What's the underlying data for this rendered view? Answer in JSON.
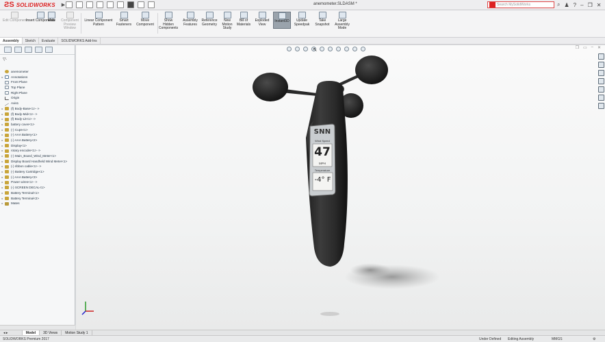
{
  "app": {
    "brand": "SOLIDWORKS",
    "document_title": "anemometer.SLDASM *"
  },
  "search": {
    "placeholder": "Search MySolidWorks"
  },
  "ribbon": [
    {
      "label": "Edit Component",
      "enabled": false
    },
    {
      "label": "Insert Components"
    },
    {
      "label": "Mate"
    },
    {
      "label": "Component Preview Window",
      "enabled": false
    },
    {
      "label": "Linear Component Pattern"
    },
    {
      "label": "Smart Fasteners"
    },
    {
      "label": "Move Component"
    },
    {
      "label": "Show Hidden Components"
    },
    {
      "label": "Assembly Features"
    },
    {
      "label": "Reference Geometry"
    },
    {
      "label": "New Motion Study"
    },
    {
      "label": "Bill of Materials"
    },
    {
      "label": "Exploded View"
    },
    {
      "label": "Instant3D",
      "active": true
    },
    {
      "label": "Update Speedpak"
    },
    {
      "label": "Take Snapshot"
    },
    {
      "label": "Large Assembly Mode"
    }
  ],
  "command_tabs": [
    "Assembly",
    "Sketch",
    "Evaluate",
    "SOLIDWORKS Add-Ins"
  ],
  "tree": {
    "root": "anemometer",
    "items": [
      {
        "label": "Annotations",
        "icon": "annotations-icon"
      },
      {
        "label": "Front Plane",
        "icon": "plane-icon"
      },
      {
        "label": "Top Plane",
        "icon": "plane-icon"
      },
      {
        "label": "Right Plane",
        "icon": "plane-icon"
      },
      {
        "label": "Origin",
        "icon": "origin-icon"
      },
      {
        "label": "Axis1",
        "icon": "axis-icon"
      },
      {
        "label": "(f) Body-Base<1> ->",
        "icon": "component-icon"
      },
      {
        "label": "(f) Body-Mid<1> ->",
        "icon": "component-icon"
      },
      {
        "label": "(f) Body-Lit<1> ->",
        "icon": "component-icon"
      },
      {
        "label": "battery cover<1>",
        "icon": "component-icon"
      },
      {
        "label": "(-) Cups<1>",
        "icon": "component-icon"
      },
      {
        "label": "(-) AAA Battery<1>",
        "icon": "component-icon"
      },
      {
        "label": "(-) AAA Battery<2>",
        "icon": "component-icon"
      },
      {
        "label": "Display<1>",
        "icon": "component-icon"
      },
      {
        "label": "rotary encoder<1> ->",
        "icon": "component-icon"
      },
      {
        "label": "(-) Main_Board_Wind_Meter<1>",
        "icon": "component-icon"
      },
      {
        "label": "Display Board Handheld Wind Meter<1>",
        "icon": "component-icon"
      },
      {
        "label": "(-) ribbon cable<1> ->",
        "icon": "component-icon"
      },
      {
        "label": "(-) Battery Cartridge<1>",
        "icon": "component-icon"
      },
      {
        "label": "(-) AAA Battery<3>",
        "icon": "component-icon"
      },
      {
        "label": "Power wires<1> ->",
        "icon": "component-icon"
      },
      {
        "label": "(-) SCREEN DECAL<1>",
        "icon": "component-icon"
      },
      {
        "label": "Battery Terminal<1>",
        "icon": "component-icon"
      },
      {
        "label": "Battery Terminal<2>",
        "icon": "component-icon"
      },
      {
        "label": "Mates",
        "icon": "mates-icon"
      }
    ]
  },
  "display": {
    "brand": "SNN",
    "label_top": "Wind Speed",
    "speed_value": "47",
    "speed_unit": "MPH",
    "label_bottom": "Temperature",
    "temperature": "-4° F"
  },
  "bottom_tabs": [
    "Model",
    "3D Views",
    "Motion Study 1"
  ],
  "status": {
    "left": "SOLIDWORKS Premium 2017",
    "state": "Under Defined",
    "mode": "Editing Assembly",
    "units": "MMGS"
  }
}
